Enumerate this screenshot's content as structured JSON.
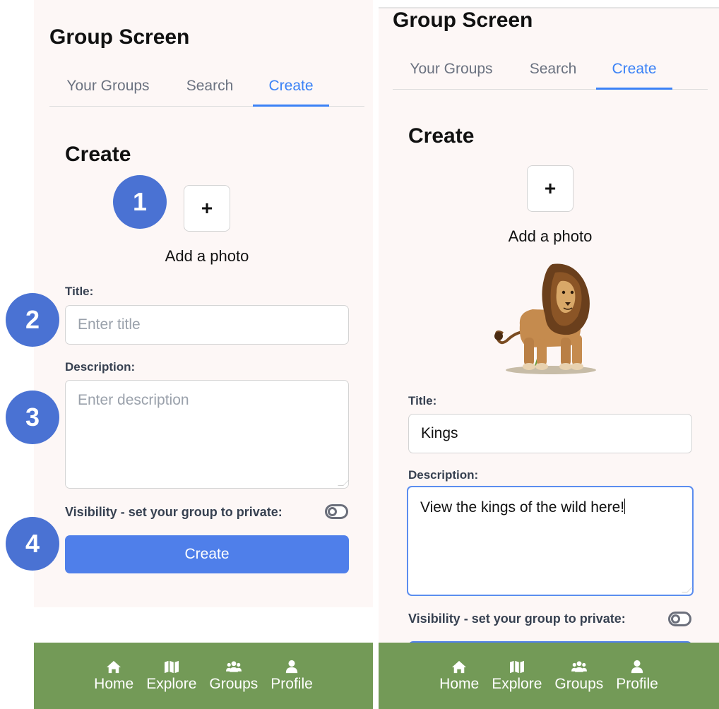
{
  "left": {
    "screen_title": "Group Screen",
    "tabs": [
      {
        "label": "Your Groups",
        "active": false
      },
      {
        "label": "Search",
        "active": false
      },
      {
        "label": "Create",
        "active": true
      }
    ],
    "section_title": "Create",
    "add_photo": {
      "button": "+",
      "label": "Add a photo"
    },
    "title_field": {
      "label": "Title:",
      "placeholder": "Enter title",
      "value": ""
    },
    "description_field": {
      "label": "Description:",
      "placeholder": "Enter description",
      "value": ""
    },
    "visibility_label": "Visibility - set your group to private:",
    "visibility_private": false,
    "create_button": "Create",
    "step_badges": [
      "1",
      "2",
      "3",
      "4"
    ]
  },
  "right": {
    "screen_title": "Group Screen",
    "tabs": [
      {
        "label": "Your Groups",
        "active": false
      },
      {
        "label": "Search",
        "active": false
      },
      {
        "label": "Create",
        "active": true
      }
    ],
    "section_title": "Create",
    "add_photo": {
      "button": "+",
      "label": "Add a photo"
    },
    "photo_subject": "lion",
    "title_field": {
      "label": "Title:",
      "value": "Kings"
    },
    "description_field": {
      "label": "Description:",
      "value": "View the kings of the wild here!"
    },
    "visibility_label": "Visibility - set your group to private:",
    "visibility_private": false
  },
  "nav": [
    {
      "label": "Home",
      "icon": "home-icon"
    },
    {
      "label": "Explore",
      "icon": "map-icon"
    },
    {
      "label": "Groups",
      "icon": "users-icon"
    },
    {
      "label": "Profile",
      "icon": "user-icon"
    }
  ],
  "colors": {
    "accent": "#3b82f6",
    "button": "#4f7fea",
    "badge": "#4a72d3",
    "nav_bg": "#739a57",
    "panel_bg": "#fdf7f6"
  }
}
